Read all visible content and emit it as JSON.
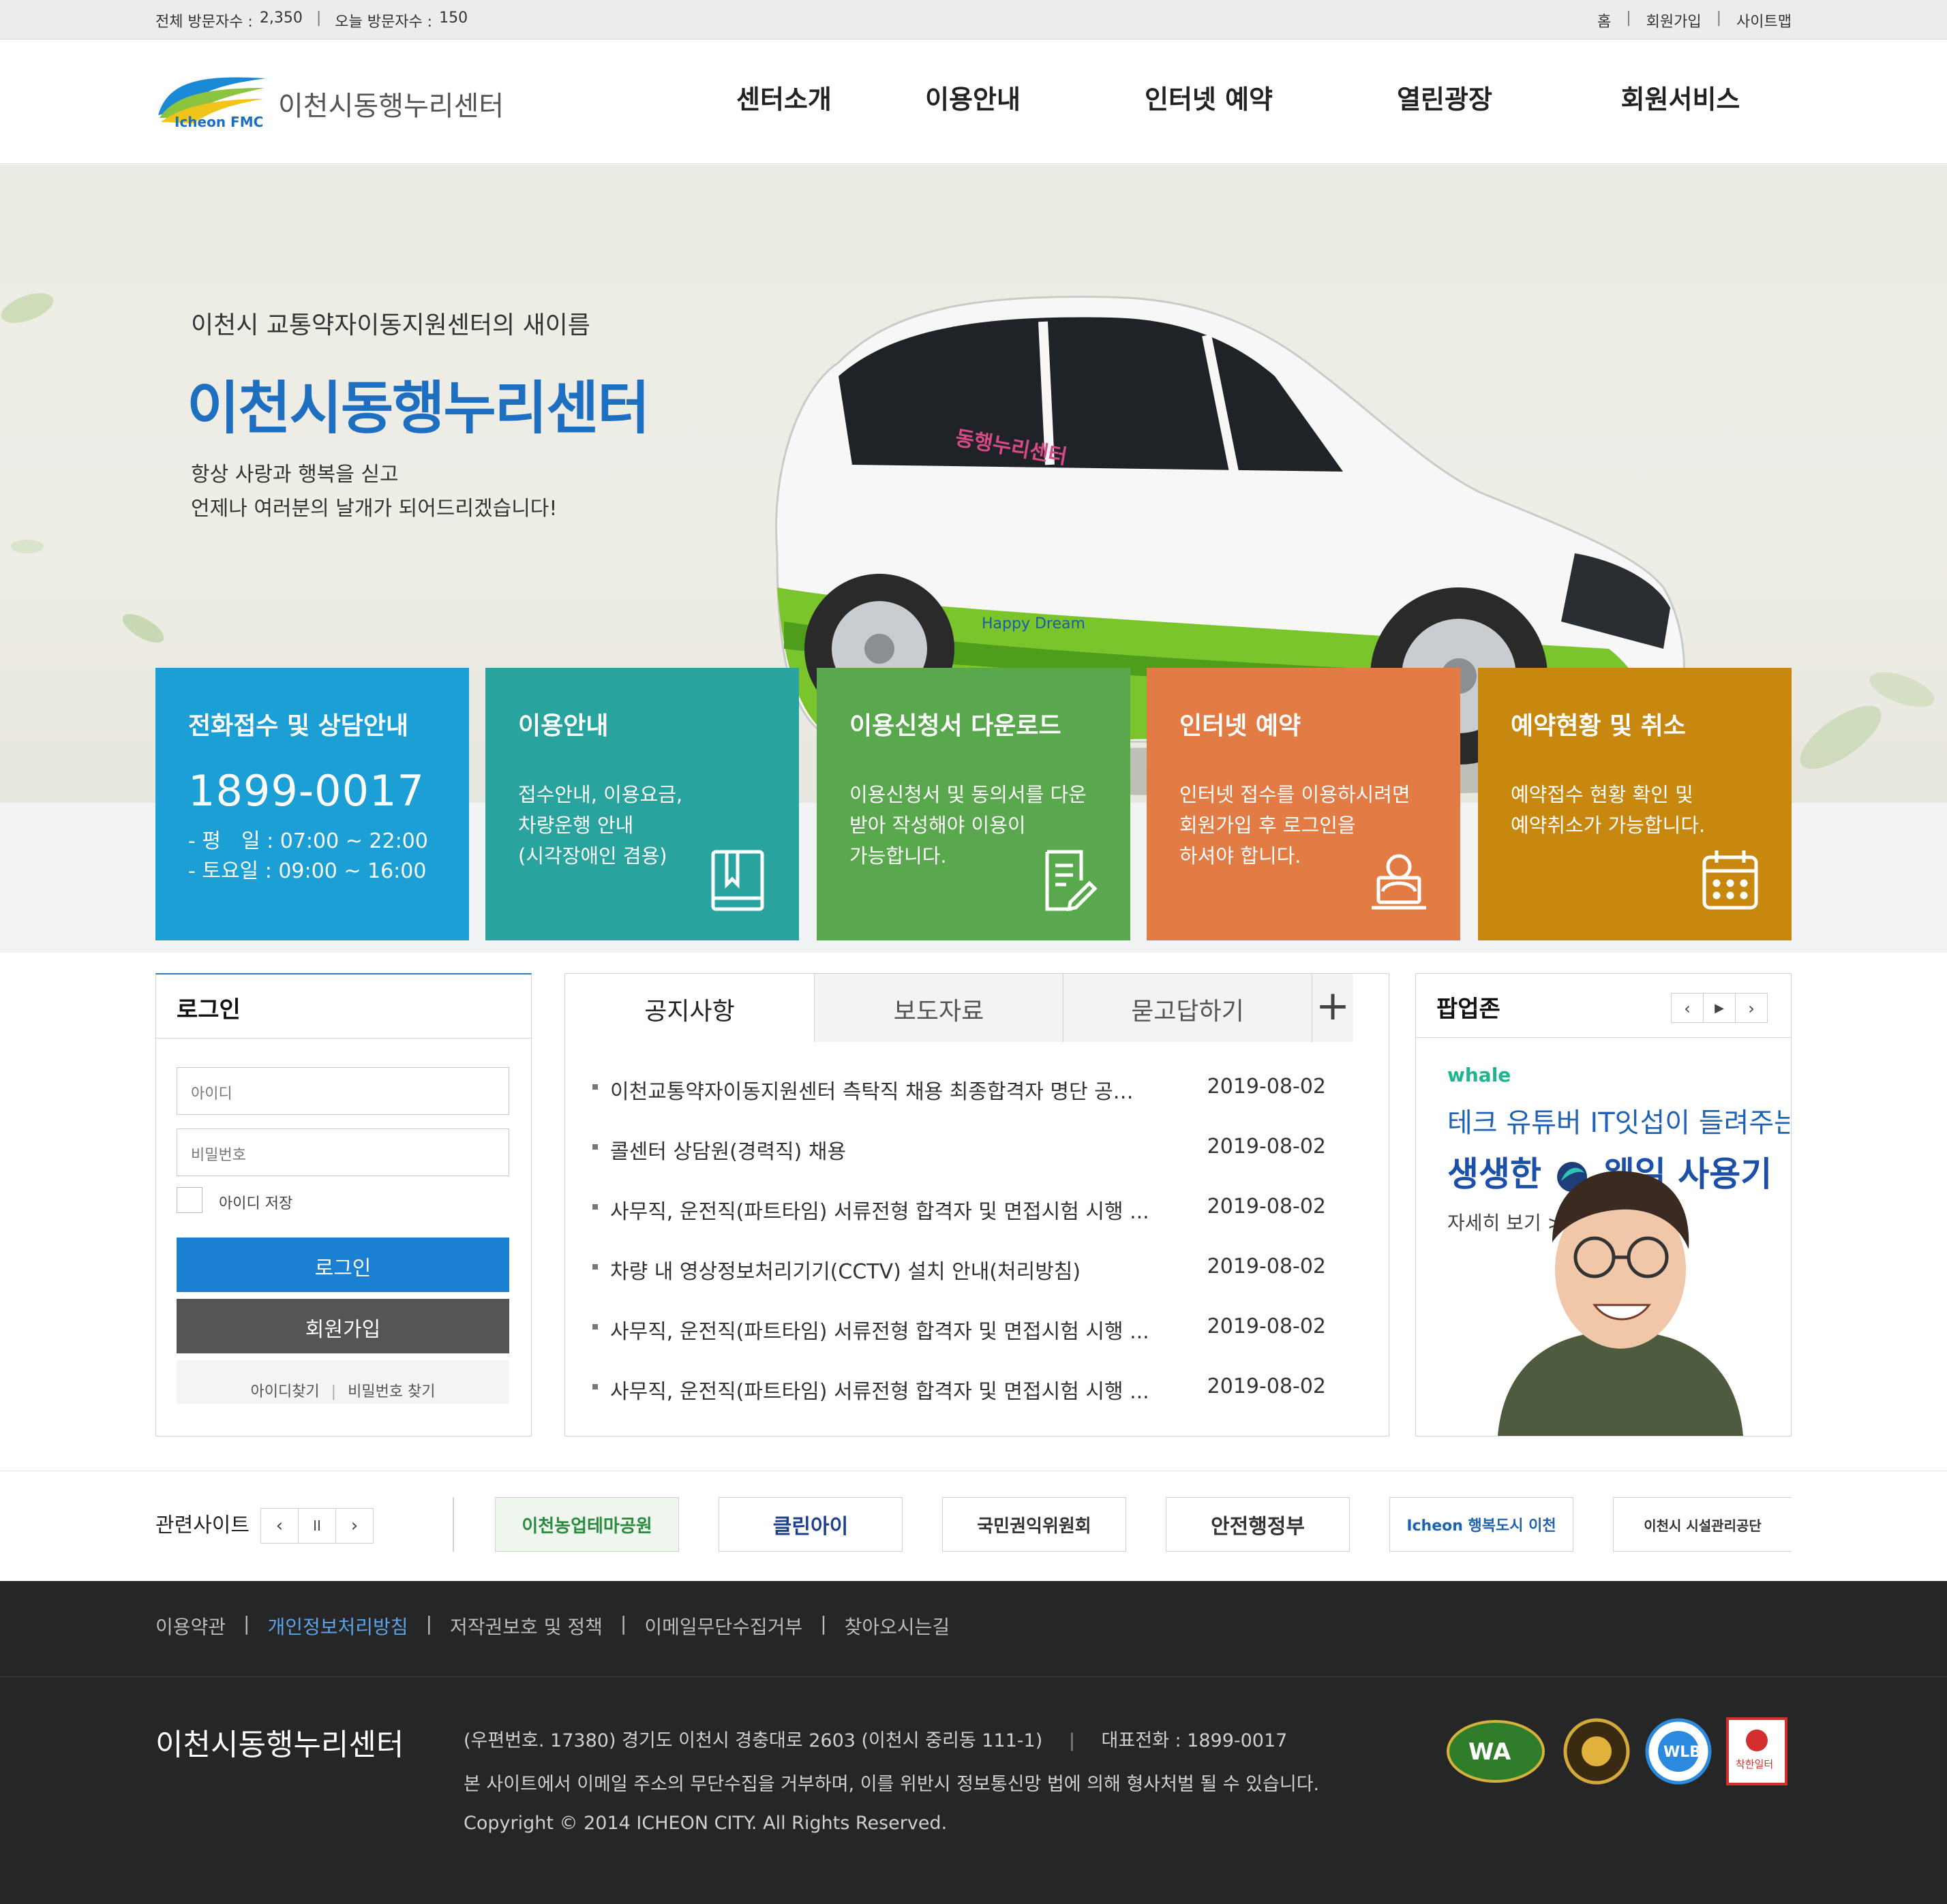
{
  "topbar": {
    "total_label": "전체 방문자수 :",
    "total_value": "2,350",
    "today_label": "오늘 방문자수 :",
    "today_value": "150",
    "divider": "|",
    "links": [
      "홈",
      "회원가입",
      "사이트맵"
    ]
  },
  "header": {
    "logo_text": "이천시동행누리센터",
    "logo_en": "Icheon FMC",
    "menu": [
      "센터소개",
      "이용안내",
      "인터넷 예약",
      "열린광장",
      "회원서비스"
    ]
  },
  "hero": {
    "subtitle": "이천시 교통약자이동지원센터의 새이름",
    "title": "이천시동행누리센터",
    "desc1": "항상 사랑과 행복을 싣고",
    "desc2": "언제나 여러분의 날개가 되어드리겠습니다!",
    "van_text1": "동행누리센터",
    "van_text2": "Happy Dream"
  },
  "quick": [
    {
      "title": "전화접수 및 상담안내",
      "tel": "1899-0017",
      "hours1": "- 평　일 : 07:00 ~ 22:00",
      "hours2": "- 토요일 : 09:00 ~ 16:00",
      "color": "#1b9fd4"
    },
    {
      "title": "이용안내",
      "line1": "접수안내, 이용요금,",
      "line2": "차량운행 안내",
      "line3": "(시각장애인 겸용)",
      "icon": "book-icon",
      "color": "#29a39e"
    },
    {
      "title": "이용신청서 다운로드",
      "line1": "이용신청서 및 동의서를 다운",
      "line2": "받아 작성해야 이용이",
      "line3": "가능합니다.",
      "icon": "document-edit-icon",
      "color": "#5aa84e"
    },
    {
      "title": "인터넷 예약",
      "line1": "인터넷 접수를 이용하시려면",
      "line2": "회원가입 후 로그인을",
      "line3": "하셔야 합니다.",
      "icon": "laptop-user-icon",
      "color": "#e27b44"
    },
    {
      "title": "예약현황 및 취소",
      "line1": "예약접수 현황 확인 및",
      "line2": "예약취소가 가능합니다.",
      "icon": "calendar-icon",
      "color": "#c8870e"
    }
  ],
  "login": {
    "title": "로그인",
    "id_placeholder": "아이디",
    "pw_placeholder": "비밀번호",
    "save_id": "아이디 저장",
    "login_btn": "로그인",
    "join_btn": "회원가입",
    "find_id": "아이디찾기",
    "find_pw": "비밀번호 찾기",
    "divider": "|",
    "primary_color": "#1b7fd2",
    "secondary_color": "#555555"
  },
  "board": {
    "tabs": [
      "공지사항",
      "보도자료",
      "묻고답하기"
    ],
    "more": "+",
    "notices": [
      {
        "title": "이천교통약자이동지원센터 측탁직 채용 최종합격자 명단 공…",
        "date": "2019-08-02"
      },
      {
        "title": "콜센터 상담원(경력직) 채용",
        "date": "2019-08-02"
      },
      {
        "title": "사무직, 운전직(파트타임) 서류전형 합격자 및 면접시험 시행 ...",
        "date": "2019-08-02"
      },
      {
        "title": "차량 내 영상정보처리기기(CCTV) 설치 안내(처리방침)",
        "date": "2019-08-02"
      },
      {
        "title": "사무직, 운전직(파트타임) 서류전형 합격자 및 면접시험 시행 ...",
        "date": "2019-08-02"
      },
      {
        "title": "사무직, 운전직(파트타임) 서류전형 합격자 및 면접시험 시행 ...",
        "date": "2019-08-02"
      }
    ]
  },
  "popup": {
    "title": "팝업존",
    "prev": "‹",
    "play": "▶",
    "next": "›",
    "brand": "whale",
    "line1": "테크 유튜버 IT잇섭이 들려주는",
    "line2a": "생생한",
    "line2b": "웨일 사용기",
    "more": "자세히 보기 >"
  },
  "related": {
    "label": "관련사이트",
    "prev": "‹",
    "pause": "II",
    "next": "›",
    "sites": [
      "이천농업테마공원",
      "클린아이",
      "국민권익위원회",
      "안전행정부",
      "Icheon 행복도시 이천",
      "이천시 시설관리공단"
    ]
  },
  "footer": {
    "links": [
      "이용약관",
      "개인정보처리방침",
      "저작권보호 및 정책",
      "이메일무단수집거부",
      "찾아오시는길"
    ],
    "divider": "|",
    "org_name": "이천시동행누리센터",
    "address": "(우편번호. 17380) 경기도 이천시 경충대로 2603 (이천시 중리동 111-1)",
    "rep_tel": "대표전화 : 1899-0017",
    "notice": "본 사이트에서 이메일 주소의 무단수집을 거부하며, 이를 위반시 정보통신망 법에 의해 형사처벌 될 수 있습니다.",
    "copyright": "Copyright © 2014 ICHEON CITY. All Rights Reserved.",
    "mark_wa": "WA",
    "mark_wlb": "WLB",
    "mark_red": "착한일터"
  }
}
